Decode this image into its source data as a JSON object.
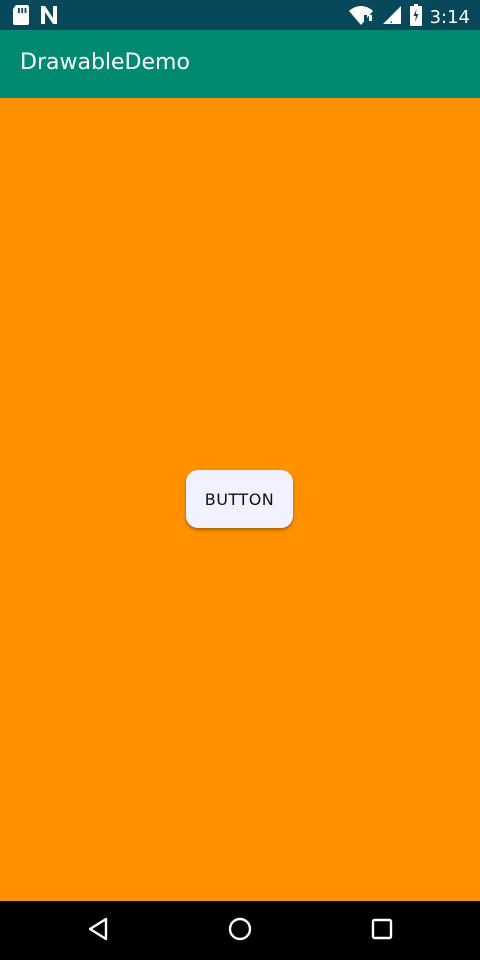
{
  "status_bar": {
    "time": "3:14",
    "left_icons": [
      "sd-card-icon",
      "n-notification-icon"
    ],
    "right_icons": [
      "wifi-icon",
      "cell-signal-icon",
      "battery-icon"
    ]
  },
  "app_bar": {
    "title": "DrawableDemo"
  },
  "main": {
    "button_label": "BUTTON"
  },
  "nav_bar": {
    "icons": [
      "back-icon",
      "home-icon",
      "recents-icon"
    ]
  },
  "colors": {
    "status_bar": "#07485a",
    "app_bar": "#008a6f",
    "content_background": "#ff9100",
    "button_background": "#f1f1ff",
    "nav_bar": "#000000"
  }
}
